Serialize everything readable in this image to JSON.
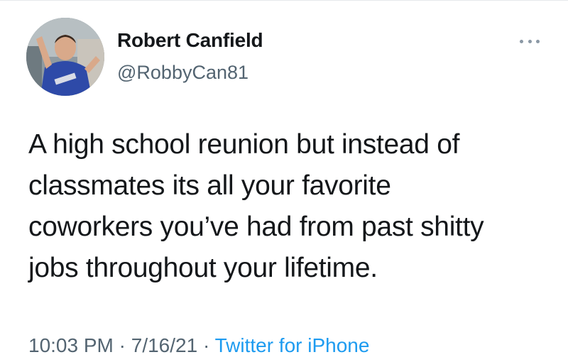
{
  "author": {
    "display_name": "Robert Canfield",
    "handle": "@RobbyCan81"
  },
  "more_icon": "more-horizontal-icon",
  "tweet": {
    "lines": [
      "A high school reunion but instead of",
      "classmates its all your favorite",
      "coworkers you’ve had from past shitty",
      "jobs throughout your lifetime."
    ]
  },
  "meta": {
    "time": "10:03 PM",
    "separator": " · ",
    "date": "7/16/21",
    "source": "Twitter for iPhone"
  },
  "colors": {
    "text": "#14171a",
    "secondary": "#536471",
    "link": "#1d9bf0"
  }
}
